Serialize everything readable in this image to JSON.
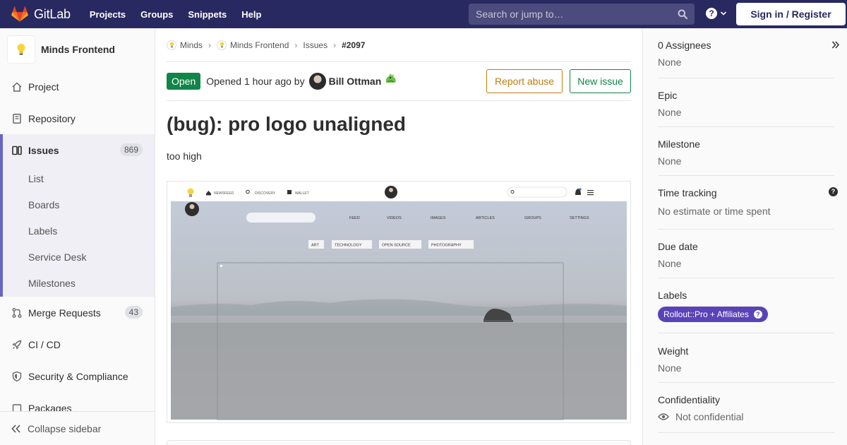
{
  "navbar": {
    "brand": "GitLab",
    "links": [
      "Projects",
      "Groups",
      "Snippets",
      "Help"
    ],
    "search_placeholder": "Search or jump to…",
    "help_glyph": "?",
    "signin": "Sign in / Register"
  },
  "sidebar": {
    "project_name": "Minds Frontend",
    "items": [
      {
        "label": "Project",
        "icon": "home-icon"
      },
      {
        "label": "Repository",
        "icon": "doc-icon"
      },
      {
        "label": "Issues",
        "icon": "issues-icon",
        "count": "869"
      },
      {
        "label": "Merge Requests",
        "icon": "merge-request-icon",
        "count": "43"
      },
      {
        "label": "CI / CD",
        "icon": "rocket-icon"
      },
      {
        "label": "Security & Compliance",
        "icon": "shield-icon"
      },
      {
        "label": "Packages",
        "icon": "package-icon"
      }
    ],
    "issues_sub": [
      "List",
      "Boards",
      "Labels",
      "Service Desk",
      "Milestones"
    ],
    "collapse": "Collapse sidebar"
  },
  "breadcrumb": [
    "Minds",
    "Minds Frontend",
    "Issues",
    "#2097"
  ],
  "issue": {
    "status": "Open",
    "opened_text": "Opened 1 hour ago by",
    "author": "Bill Ottman",
    "report_abuse": "Report abuse",
    "new_issue": "New issue",
    "title": "(bug): pro logo unaligned",
    "description": "too high"
  },
  "screenshot": {
    "nav": [
      "NEWSFEED",
      "DISCOVERY",
      "WALLET"
    ],
    "menu": [
      "FEED",
      "VIDEOS",
      "IMAGES",
      "ARTICLES",
      "GROUPS",
      "SETTINGS"
    ],
    "tags": [
      "ART",
      "TECHNOLOGY",
      "OPEN SOURCE",
      "PHOTOGRAPHY"
    ]
  },
  "right_sidebar": {
    "assignees_title": "0 Assignees",
    "assignees_value": "None",
    "epic_title": "Epic",
    "epic_value": "None",
    "milestone_title": "Milestone",
    "milestone_value": "None",
    "time_title": "Time tracking",
    "time_value": "No estimate or time spent",
    "due_title": "Due date",
    "due_value": "None",
    "labels_title": "Labels",
    "label_pill": "Rollout::Pro + Affiliates",
    "weight_title": "Weight",
    "weight_value": "None",
    "conf_title": "Confidentiality",
    "conf_value": "Not confidential",
    "help_glyph": "?"
  },
  "colors": {
    "navbar": "#292961",
    "open_status": "#108548",
    "report_abuse": "#c17d10",
    "label_pill": "#5943b6",
    "active_bar": "#6666c4"
  }
}
